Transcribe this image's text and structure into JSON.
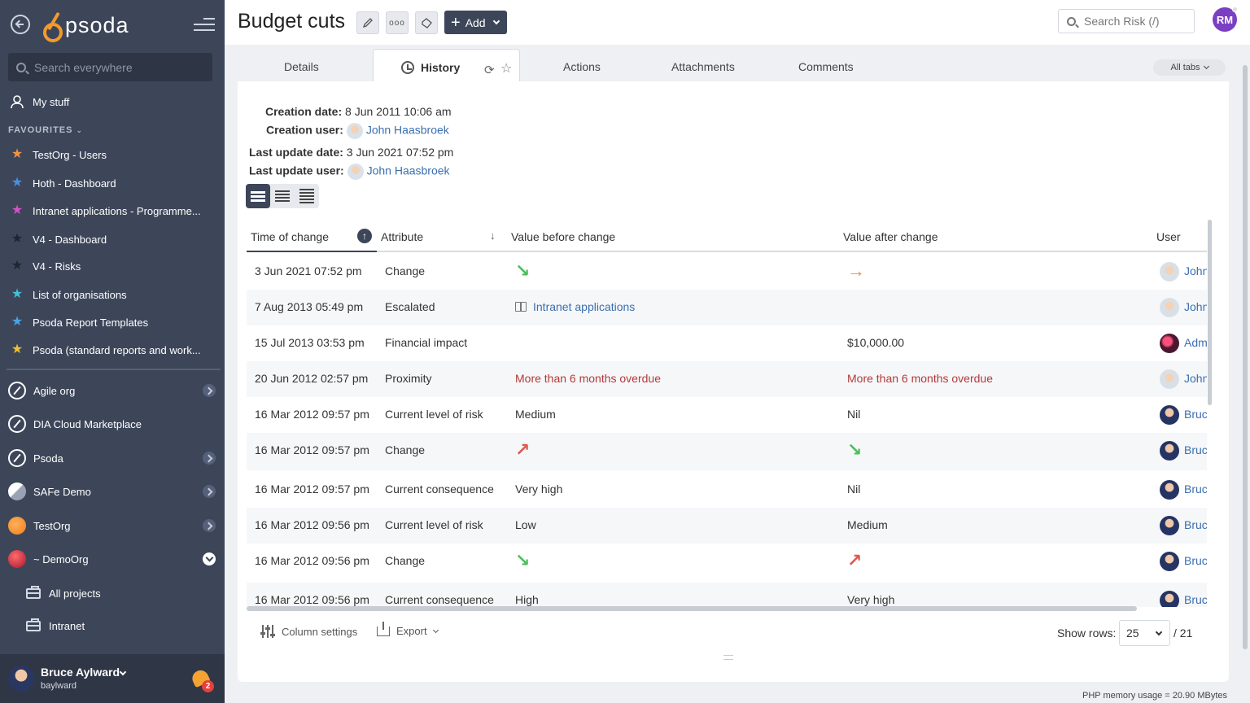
{
  "sidebar": {
    "logo": "psoda",
    "search_placeholder": "Search everywhere",
    "my_stuff": "My stuff",
    "favourites_label": "FAVOURITES",
    "favourites": [
      {
        "label": "TestOrg - Users",
        "color": "#f4923a"
      },
      {
        "label": "Hoth - Dashboard",
        "color": "#4a90e2"
      },
      {
        "label": "Intranet applications - Programme...",
        "color": "#d64fc9"
      },
      {
        "label": "V4 - Dashboard",
        "color": "#1e2430"
      },
      {
        "label": "V4 - Risks",
        "color": "#1e2430"
      },
      {
        "label": "List of organisations",
        "color": "#3ec2d6"
      },
      {
        "label": "Psoda Report Templates",
        "color": "#4aa3e8"
      },
      {
        "label": "Psoda (standard reports and work...",
        "color": "#f2c035"
      }
    ],
    "orgs": [
      {
        "label": "Agile org",
        "icon": "compass-icon"
      },
      {
        "label": "DIA Cloud Marketplace",
        "icon": "compass-icon"
      },
      {
        "label": "Psoda",
        "icon": "compass-icon"
      },
      {
        "label": "SAFe Demo",
        "icon": "org-logo-icon"
      },
      {
        "label": "TestOrg",
        "icon": "org-logo-icon"
      },
      {
        "label": "~ DemoOrg",
        "icon": "org-logo-icon"
      }
    ],
    "sub_items": [
      "All projects",
      "Intranet"
    ],
    "user": {
      "name": "Bruce Aylward",
      "username": "baylward",
      "notifications": "2"
    }
  },
  "header": {
    "title": "Budget cuts",
    "add_label": "Add",
    "search_placeholder": "Search Risk (/)",
    "avatar_initials": "RM"
  },
  "tabs": {
    "details": "Details",
    "history": "History",
    "actions": "Actions",
    "attachments": "Attachments",
    "comments": "Comments",
    "all_tabs": "All tabs"
  },
  "meta": {
    "creation_date_label": "Creation date:",
    "creation_date": "8 Jun 2011 10:06 am",
    "creation_user_label": "Creation user:",
    "creation_user": "John Haasbroek",
    "last_update_date_label": "Last update date:",
    "last_update_date": "3 Jun 2021 07:52 pm",
    "last_update_user_label": "Last update user:",
    "last_update_user": "John Haasbroek"
  },
  "table": {
    "columns": [
      "Time of change",
      "Attribute",
      "Value before change",
      "Value after change",
      "User"
    ],
    "rows": [
      {
        "time": "3 Jun 2021 07:52 pm",
        "attribute": "Change",
        "before": "",
        "before_icon": "arrow-down-right-green",
        "after": "",
        "after_icon": "arrow-right-orange",
        "user": "John",
        "avatar": "john"
      },
      {
        "time": "7 Aug 2013 05:49 pm",
        "attribute": "Escalated",
        "before": "Intranet applications",
        "before_icon": "",
        "after": "",
        "after_icon": "",
        "user": "John",
        "avatar": "john"
      },
      {
        "time": "15 Jul 2013 03:53 pm",
        "attribute": "Financial impact",
        "before": "",
        "before_icon": "",
        "after": "$10,000.00",
        "after_icon": "",
        "user": "Adm",
        "avatar": "adm"
      },
      {
        "time": "20 Jun 2012 02:57 pm",
        "attribute": "Proximity",
        "before": "More than 6 months overdue",
        "before_icon": "",
        "after": "More than 6 months overdue",
        "after_icon": "",
        "user": "John",
        "avatar": "john"
      },
      {
        "time": "16 Mar 2012 09:57 pm",
        "attribute": "Current level of risk",
        "before": "Medium",
        "before_icon": "",
        "after": "Nil",
        "after_icon": "",
        "user": "Bruc",
        "avatar": "bruce"
      },
      {
        "time": "16 Mar 2012 09:57 pm",
        "attribute": "Change",
        "before": "",
        "before_icon": "arrow-up-right-red",
        "after": "",
        "after_icon": "arrow-down-right-green",
        "user": "Bruc",
        "avatar": "bruce"
      },
      {
        "time": "16 Mar 2012 09:57 pm",
        "attribute": "Current consequence",
        "before": "Very high",
        "before_icon": "",
        "after": "Nil",
        "after_icon": "",
        "user": "Bruc",
        "avatar": "bruce"
      },
      {
        "time": "16 Mar 2012 09:56 pm",
        "attribute": "Current level of risk",
        "before": "Low",
        "before_icon": "",
        "after": "Medium",
        "after_icon": "",
        "user": "Bruc",
        "avatar": "bruce"
      },
      {
        "time": "16 Mar 2012 09:56 pm",
        "attribute": "Change",
        "before": "",
        "before_icon": "arrow-down-right-green",
        "after": "",
        "after_icon": "arrow-up-right-red",
        "user": "Bruc",
        "avatar": "bruce"
      },
      {
        "time": "16 Mar 2012 09:56 pm",
        "attribute": "Current consequence",
        "before": "High",
        "before_icon": "",
        "after": "Very high",
        "after_icon": "",
        "user": "Bruc",
        "avatar": "bruce"
      }
    ]
  },
  "footer": {
    "column_settings": "Column settings",
    "export": "Export",
    "show_rows_label": "Show rows:",
    "show_rows_value": "25",
    "total": "/ 21",
    "memory": "PHP memory usage = 20.90 MBytes"
  },
  "colors": {
    "sidebar_bg": "#3d4659",
    "accent": "#3d4659",
    "link": "#3a6fb0",
    "overdue_red": "#b23a3a"
  }
}
